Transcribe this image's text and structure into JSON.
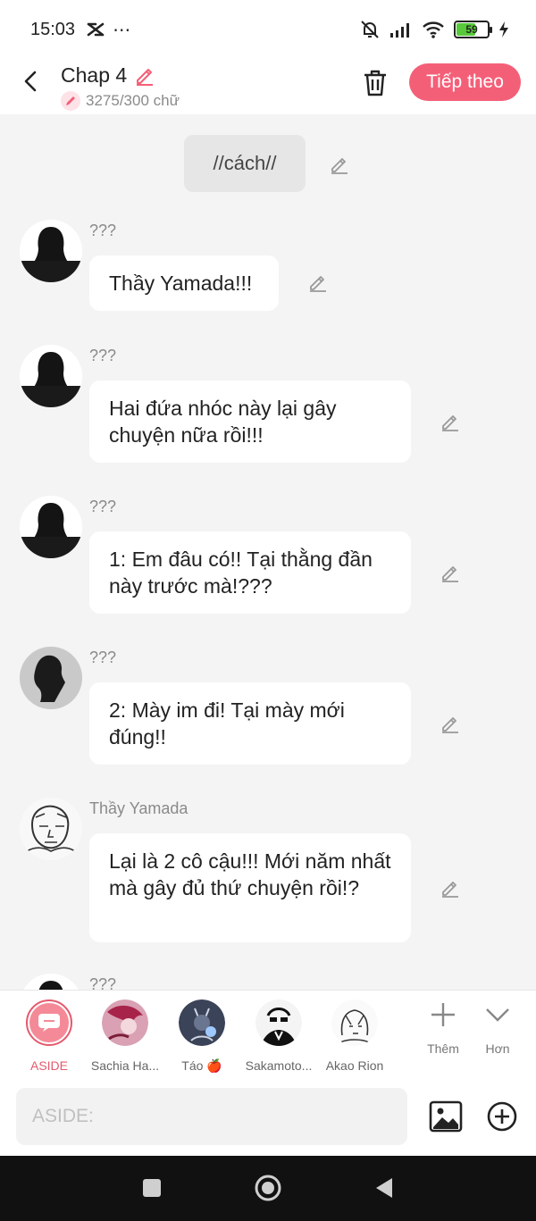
{
  "status": {
    "time": "15:03",
    "extra": "⋯",
    "battery_level": "59",
    "battery_fraction": 0.59
  },
  "header": {
    "title": "Chap 4",
    "word_count": "3275/300 chữ",
    "next_label": "Tiếp theo"
  },
  "chat": {
    "aside_text": "//cách//",
    "messages": [
      {
        "sender": "???",
        "text": "Thầy Yamada!!!"
      },
      {
        "sender": "???",
        "text": "Hai đứa nhóc này lại gây chuyện nữa rồi!!!"
      },
      {
        "sender": "???",
        "text": "1: Em đâu có!! Tại thằng đần này trước mà!???"
      },
      {
        "sender": "???",
        "text": "2: Mày im đi! Tại mày mới đúng!!"
      },
      {
        "sender": "Thầy Yamada",
        "text": "Lại là 2 cô cậu!!! Mới năm nhất mà gây đủ thứ chuyện rồi!?"
      },
      {
        "sender": "???",
        "text": ""
      }
    ]
  },
  "characters": [
    {
      "label": "ASIDE",
      "active": true
    },
    {
      "label": "Sachia Ha..."
    },
    {
      "label": "Táo 🍎"
    },
    {
      "label": "Sakamoto..."
    },
    {
      "label": "Akao Rion"
    }
  ],
  "tools": {
    "more_label": "Thêm",
    "collapse_label": "Hơn"
  },
  "input": {
    "placeholder": "ASIDE:"
  },
  "colors": {
    "accent": "#f45f78",
    "bubble": "#ffffff",
    "background": "#f4f4f4"
  }
}
